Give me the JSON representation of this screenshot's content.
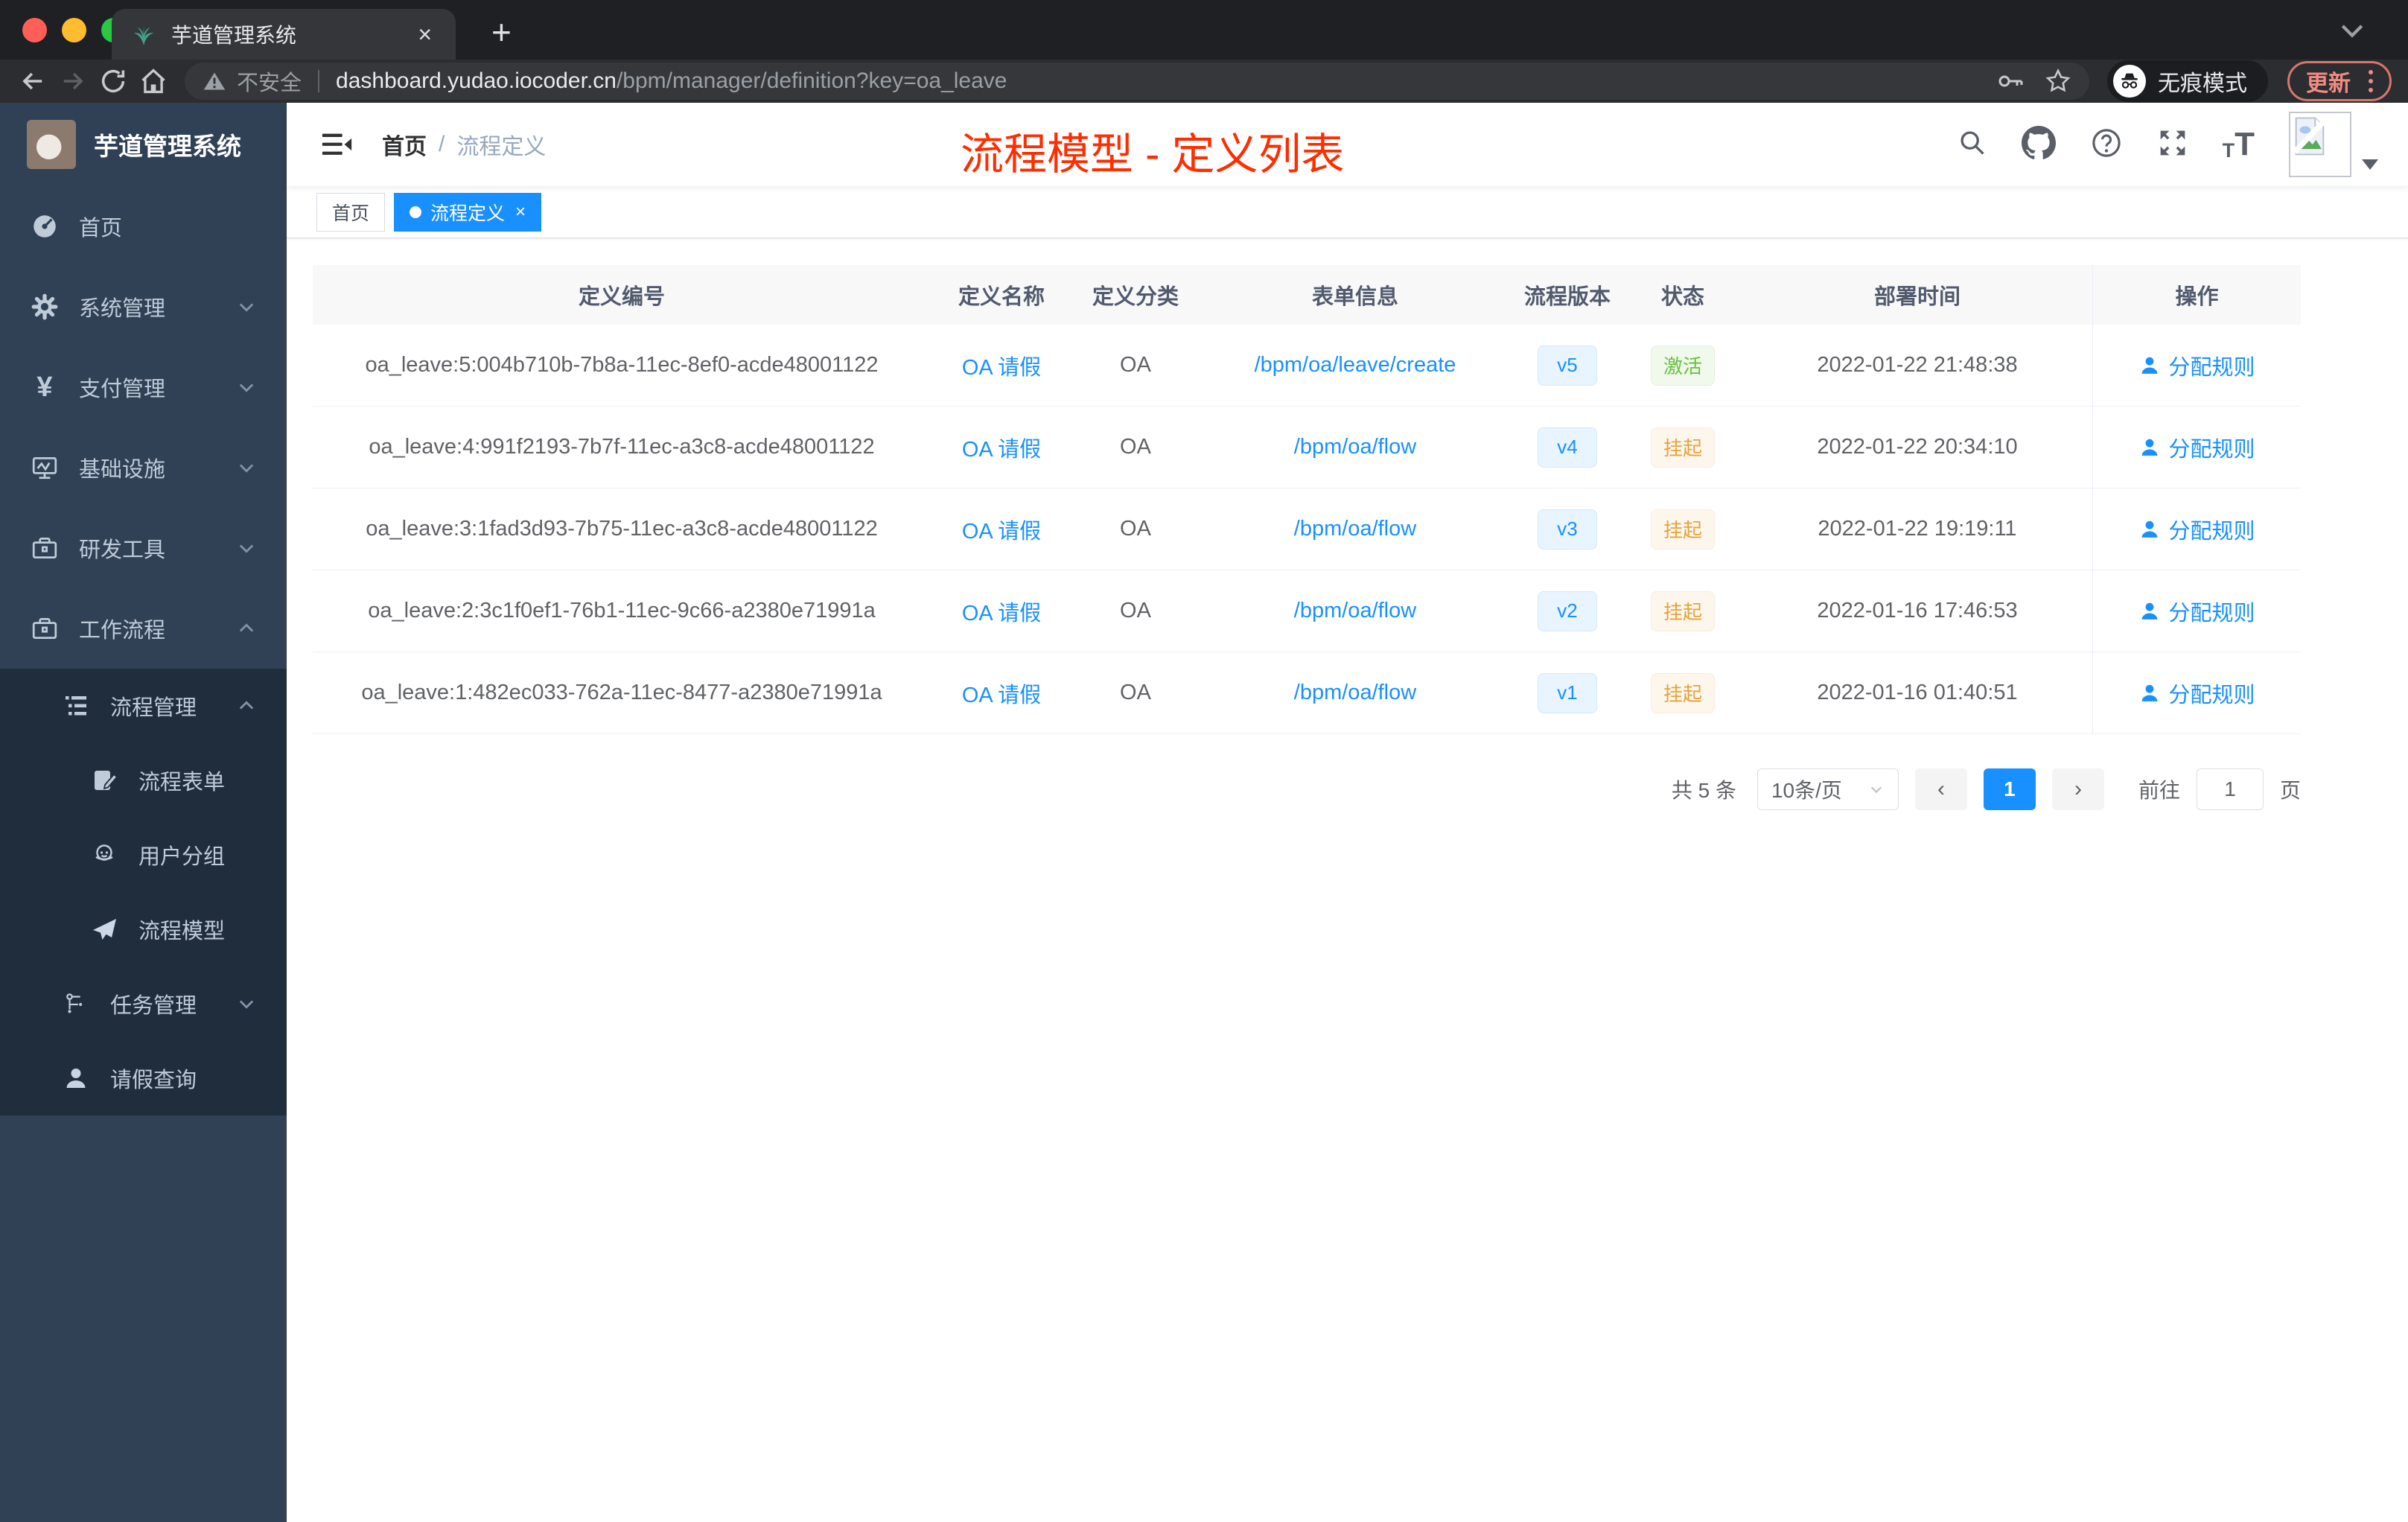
{
  "colors": {
    "primary": "#1890ff",
    "success": "#67c23a",
    "warning": "#e6a23c",
    "annotation_red": "#ff2d00",
    "sidebar_bg": "#304156",
    "submenu_bg": "#1f2d3d",
    "table_header_bg": "#f8f8f9"
  },
  "browser": {
    "tab": {
      "title": "芋道管理系统",
      "close_glyph": "×",
      "new_tab_glyph": "+"
    },
    "toolbar": {
      "security_warning": "不安全",
      "url_host": "dashboard.yudao.iocoder.cn",
      "url_path": "/bpm/manager/definition?key=oa_leave",
      "incognito_label": "无痕模式",
      "update_label": "更新"
    }
  },
  "sidebar": {
    "logo_title": "芋道管理系统",
    "items": [
      {
        "label": "首页",
        "icon": "dashboard-icon"
      },
      {
        "label": "系统管理",
        "icon": "gear-icon"
      },
      {
        "label": "支付管理",
        "icon": "yen-icon"
      },
      {
        "label": "基础设施",
        "icon": "monitor-icon"
      },
      {
        "label": "研发工具",
        "icon": "toolbox-icon"
      },
      {
        "label": "工作流程",
        "icon": "briefcase-icon"
      },
      {
        "label": "流程管理",
        "icon": "tree-table-icon"
      },
      {
        "label": "流程表单",
        "icon": "form-icon"
      },
      {
        "label": "用户分组",
        "icon": "robot-icon"
      },
      {
        "label": "流程模型",
        "icon": "paper-plane-icon"
      },
      {
        "label": "任务管理",
        "icon": "org-tree-icon"
      },
      {
        "label": "请假查询",
        "icon": "user-icon"
      }
    ]
  },
  "header": {
    "breadcrumb_home": "首页",
    "breadcrumb_sep": "/",
    "breadcrumb_current": "流程定义",
    "annotation": "流程模型 - 定义列表",
    "font_icon_small": "T",
    "font_icon_large": "T"
  },
  "tags": [
    {
      "label": "首页",
      "active": false
    },
    {
      "label": "流程定义",
      "active": true,
      "close_glyph": "×"
    }
  ],
  "table": {
    "columns": [
      "定义编号",
      "定义名称",
      "定义分类",
      "表单信息",
      "流程版本",
      "状态",
      "部署时间",
      "操作"
    ],
    "rows": [
      {
        "id": "oa_leave:5:004b710b-7b8a-11ec-8ef0-acde48001122",
        "name": "OA 请假",
        "category": "OA",
        "form": "/bpm/oa/leave/create",
        "version": "v5",
        "status": "激活",
        "deploy_time": "2022-01-22 21:48:38",
        "action": "分配规则"
      },
      {
        "id": "oa_leave:4:991f2193-7b7f-11ec-a3c8-acde48001122",
        "name": "OA 请假",
        "category": "OA",
        "form": "/bpm/oa/flow",
        "version": "v4",
        "status": "挂起",
        "deploy_time": "2022-01-22 20:34:10",
        "action": "分配规则"
      },
      {
        "id": "oa_leave:3:1fad3d93-7b75-11ec-a3c8-acde48001122",
        "name": "OA 请假",
        "category": "OA",
        "form": "/bpm/oa/flow",
        "version": "v3",
        "status": "挂起",
        "deploy_time": "2022-01-22 19:19:11",
        "action": "分配规则"
      },
      {
        "id": "oa_leave:2:3c1f0ef1-76b1-11ec-9c66-a2380e71991a",
        "name": "OA 请假",
        "category": "OA",
        "form": "/bpm/oa/flow",
        "version": "v2",
        "status": "挂起",
        "deploy_time": "2022-01-16 17:46:53",
        "action": "分配规则"
      },
      {
        "id": "oa_leave:1:482ec033-762a-11ec-8477-a2380e71991a",
        "name": "OA 请假",
        "category": "OA",
        "form": "/bpm/oa/flow",
        "version": "v1",
        "status": "挂起",
        "deploy_time": "2022-01-16 01:40:51",
        "action": "分配规则"
      }
    ]
  },
  "pagination": {
    "total_text": "共 5 条",
    "page_size": "10条/页",
    "prev_glyph": "‹",
    "current_page": "1",
    "next_glyph": "›",
    "goto_label": "前往",
    "goto_value": "1",
    "page_unit": "页"
  }
}
